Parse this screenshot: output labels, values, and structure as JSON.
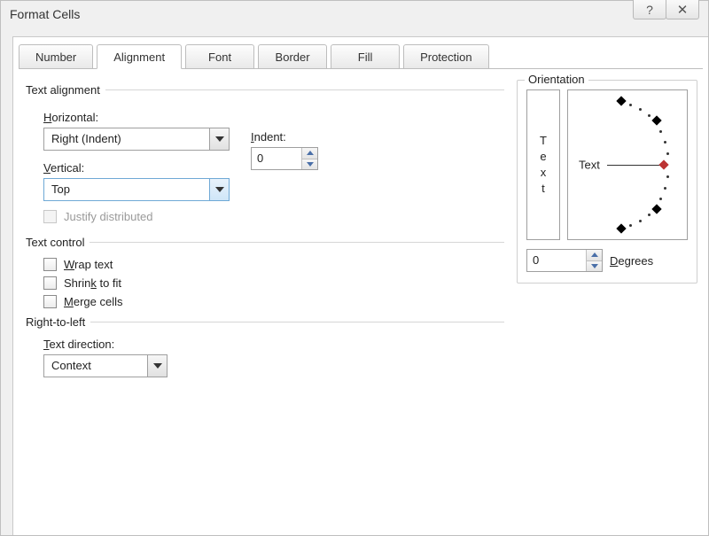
{
  "window": {
    "title": "Format Cells"
  },
  "tabs": {
    "number": "Number",
    "alignment": "Alignment",
    "font": "Font",
    "border": "Border",
    "fill": "Fill",
    "protection": "Protection"
  },
  "groups": {
    "textAlignment": "Text alignment",
    "textControl": "Text control",
    "rightToLeft": "Right-to-left",
    "orientation": "Orientation"
  },
  "labels": {
    "horizontal_pre": "H",
    "horizontal_post": "orizontal:",
    "vertical_pre": "V",
    "vertical_post": "ertical:",
    "indent_pre": "I",
    "indent_post": "ndent:",
    "textDirection_pre": "T",
    "textDirection_post": "ext direction:",
    "degrees_pre": "D",
    "degrees_post": "egrees",
    "justifyDistributed": "Justify distributed",
    "wrap_pre": "W",
    "wrap_post": "rap text",
    "shrink_pre": "Shrin",
    "shrink_under": "k",
    "shrink_post": " to fit",
    "merge_pre": "M",
    "merge_post": "erge cells"
  },
  "values": {
    "horizontal": "Right (Indent)",
    "vertical": "Top",
    "indent": "0",
    "textDirection": "Context",
    "degrees": "0",
    "orientationVertical": [
      "T",
      "e",
      "x",
      "t"
    ],
    "orientationDialLabel": "Text"
  }
}
